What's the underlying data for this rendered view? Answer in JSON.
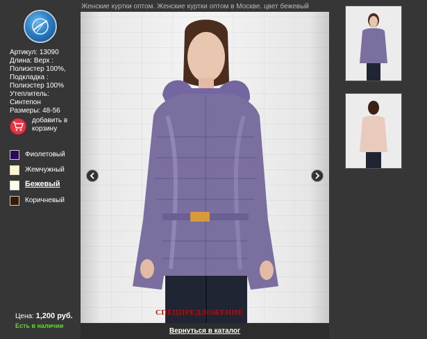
{
  "product": {
    "title": "Женские куртки оптом. Женские куртки оптом в Москве. цвет бежевый",
    "specs": [
      "Артикул: 13090",
      "Длина: Верх :",
      "Полиэстер 100%,",
      "Подкладка :",
      "Полиэстер 100%",
      "Утеплитель:",
      "Синтепон",
      "Размеры: 48-56"
    ],
    "add_to_cart": "добавить в корзину",
    "colors": [
      {
        "label": "Фиолетовый",
        "hex": "#2a0a5a"
      },
      {
        "label": "Жемчужный",
        "hex": "#fff6c8"
      },
      {
        "label": "Бежевый",
        "hex": "#fffce8"
      },
      {
        "label": "Коричневый",
        "hex": "#3a1a05"
      }
    ],
    "selected_color_index": 2,
    "price_label": "Цена:",
    "price_value": "1,200 руб.",
    "stock": "Есть в наличии",
    "special_offer": "СПЕЦПРЕДЛОЖЕНИЕ",
    "back_link": "Вернуться в каталог"
  },
  "icons": {
    "logo": "logo-globe-icon",
    "cart": "cart-icon",
    "prev": "chevron-left-icon",
    "next": "chevron-right-icon"
  },
  "colors": {
    "background": "#363636",
    "stock_green": "#5bdc2c",
    "offer_red": "#b30d0d",
    "cart_red": "#e53347",
    "jacket_purple": "#7b6fa0",
    "jacket_beige": "#e9cbbd"
  }
}
